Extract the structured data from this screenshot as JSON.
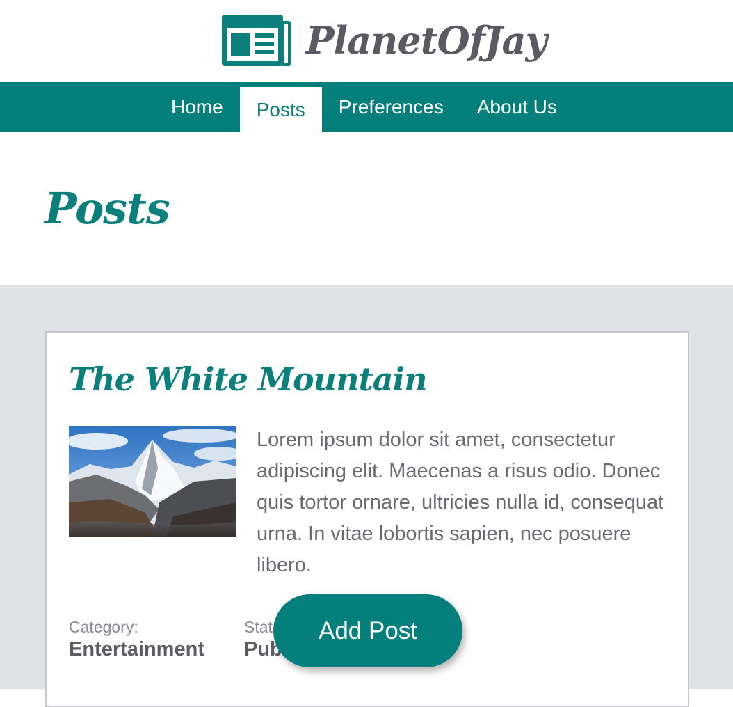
{
  "brand": {
    "name": "PlanetOfJay",
    "logo_icon": "newspaper-icon"
  },
  "nav": {
    "items": [
      {
        "label": "Home",
        "active": false
      },
      {
        "label": "Posts",
        "active": true
      },
      {
        "label": "Preferences",
        "active": false
      },
      {
        "label": "About Us",
        "active": false
      }
    ]
  },
  "page": {
    "title": "Posts"
  },
  "posts": [
    {
      "title": "The White Mountain",
      "image": "mountain-photo",
      "excerpt": "Lorem ipsum dolor sit amet, consectetur adipiscing elit. Maecenas a risus odio. Donec quis tortor ornare, ultricies nulla id, consequat urna. In vitae lobortis sapien, nec posuere libero.",
      "category_label": "Category:",
      "category_value": "Entertainment",
      "status_label": "Stat",
      "status_value": "Pub"
    }
  ],
  "fab": {
    "label": "Add Post"
  },
  "colors": {
    "primary": "#057f7c",
    "brand_text": "#5b5962",
    "content_bg": "#e1e2e6"
  }
}
